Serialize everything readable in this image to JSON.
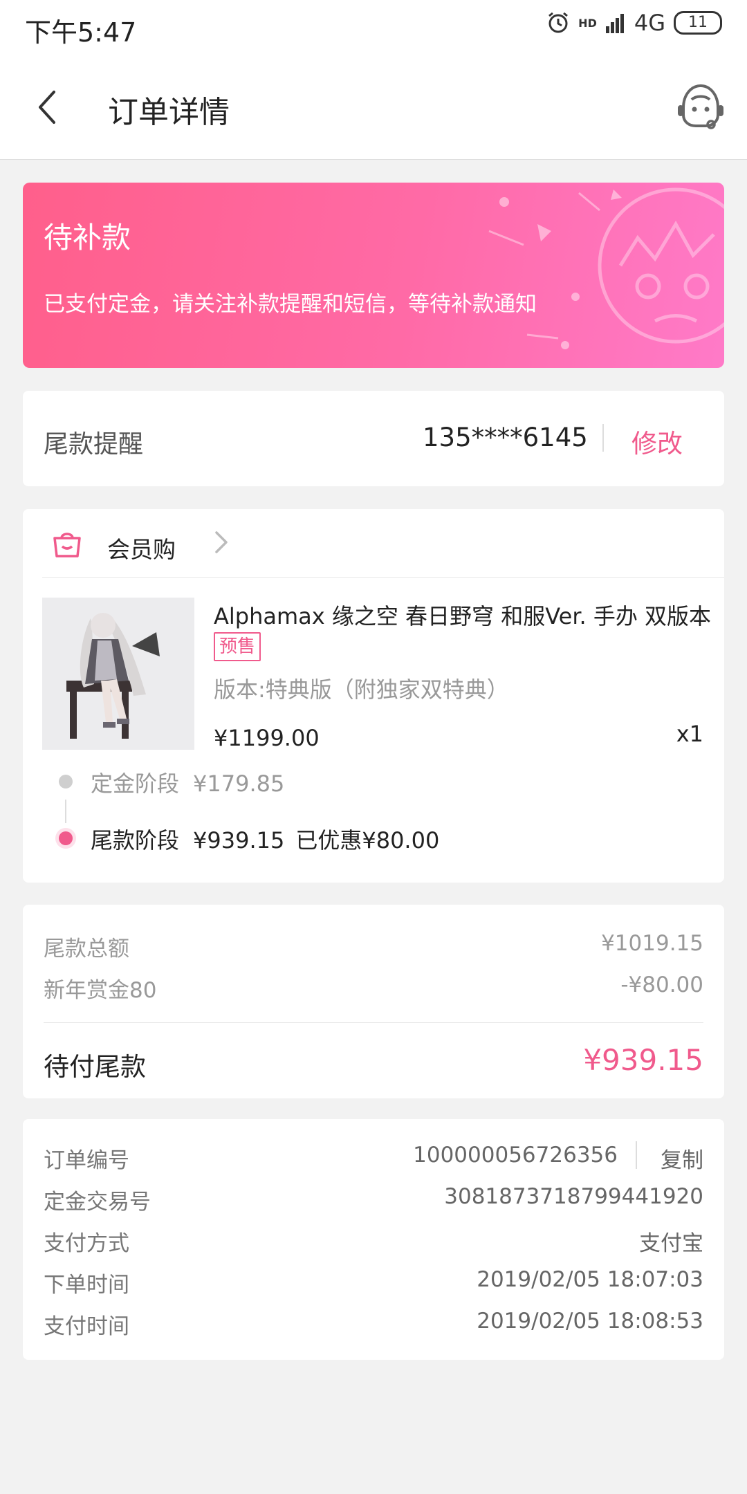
{
  "status_bar": {
    "time": "下午5:47",
    "network": "4G",
    "signal_label": "HD",
    "battery": "11"
  },
  "header": {
    "title": "订单详情"
  },
  "banner": {
    "status": "待补款",
    "description": "已支付定金，请关注补款提醒和短信，等待补款通知"
  },
  "reminder": {
    "label": "尾款提醒",
    "phone": "135****6145",
    "edit_label": "修改"
  },
  "shop": {
    "name": "会员购"
  },
  "product": {
    "title": "Alphamax 缘之空 春日野穹 和服Ver. 手办 双版本",
    "tag": "预售",
    "spec": "版本:特典版（附独家双特典）",
    "price": "¥1199.00",
    "quantity": "x1"
  },
  "stages": {
    "deposit_label": "定金阶段",
    "deposit_value": "¥179.85",
    "balance_label": "尾款阶段",
    "balance_value": "¥939.15",
    "balance_discount": "已优惠¥80.00"
  },
  "summary": {
    "total_label": "尾款总额",
    "total_value": "¥1019.15",
    "bonus_label": "新年赏金80",
    "bonus_value": "-¥80.00",
    "due_label": "待付尾款",
    "due_value": "¥939.15"
  },
  "order_info": {
    "order_no_label": "订单编号",
    "order_no": "100000056726356",
    "copy_label": "复制",
    "deposit_tx_label": "定金交易号",
    "deposit_tx": "3081873718799441920",
    "pay_method_label": "支付方式",
    "pay_method": "支付宝",
    "order_time_label": "下单时间",
    "order_time": "2019/02/05 18:07:03",
    "pay_time_label": "支付时间",
    "pay_time": "2019/02/05 18:08:53"
  },
  "colors": {
    "accent": "#f05a8c",
    "banner_start": "#ff5f8b",
    "banner_end": "#ff7ac8",
    "background": "#f2f2f2"
  }
}
